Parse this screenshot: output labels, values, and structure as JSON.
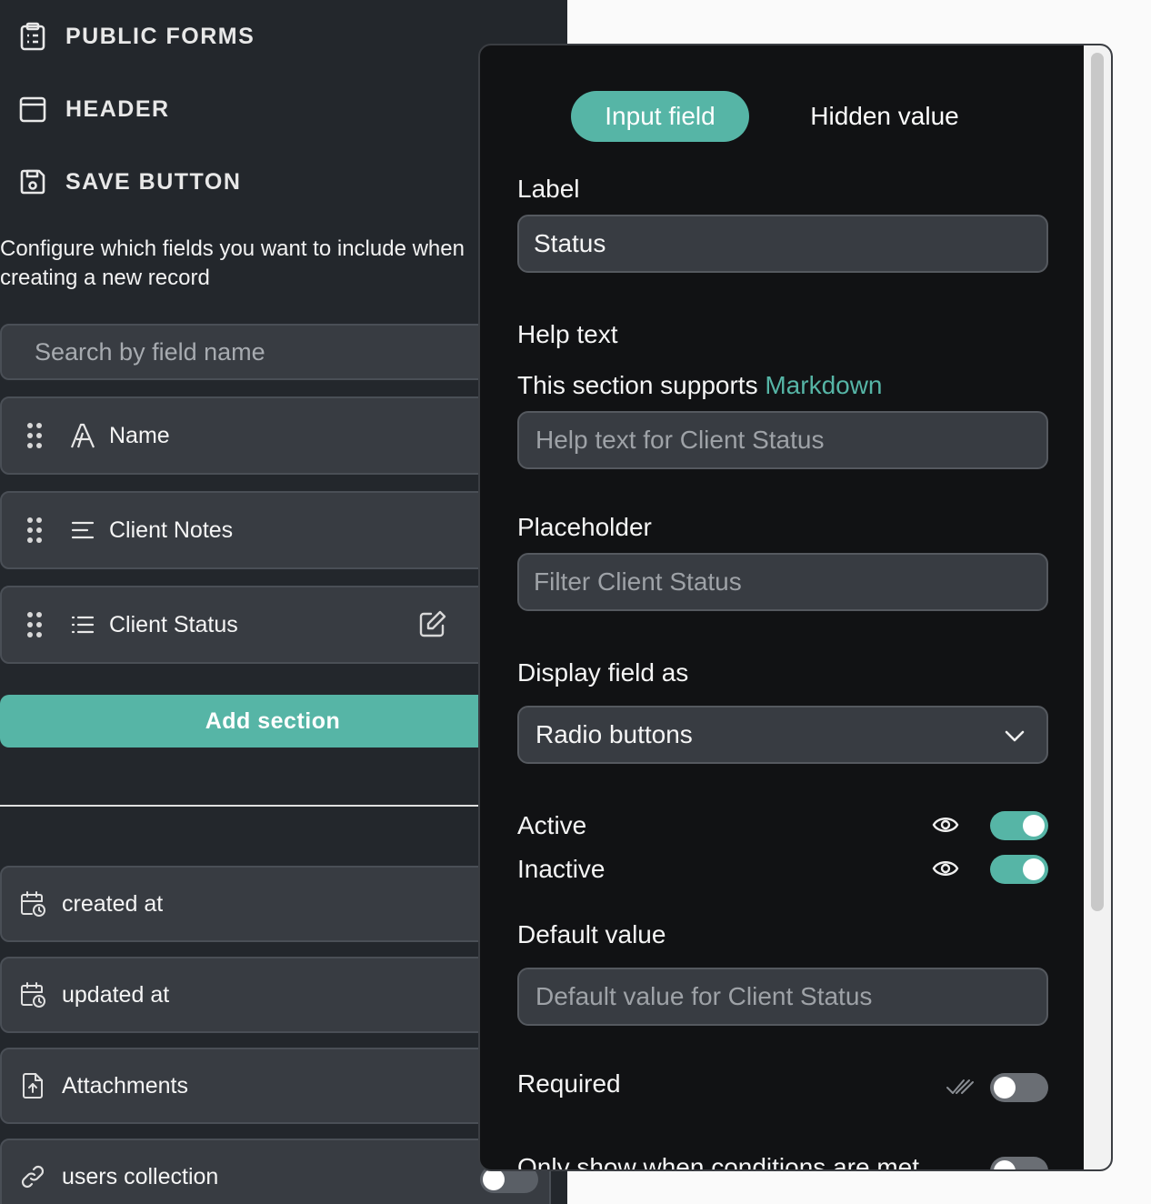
{
  "sidebar": {
    "nav": [
      {
        "label": "PUBLIC FORMS",
        "icon": "clipboard-list-icon"
      },
      {
        "label": "HEADER",
        "icon": "window-header-icon"
      },
      {
        "label": "SAVE BUTTON",
        "icon": "save-floppy-icon"
      }
    ],
    "description": "Configure which fields you want to include when creating a new record",
    "search_placeholder": "Search by field name",
    "fields": [
      {
        "name": "Name",
        "type_icon": "text-type-icon"
      },
      {
        "name": "Client Notes",
        "type_icon": "long-text-icon"
      },
      {
        "name": "Client Status",
        "type_icon": "list-icon"
      }
    ],
    "add_section_label": "Add section",
    "meta_fields": [
      {
        "name": "created at",
        "icon": "calendar-clock-icon"
      },
      {
        "name": "updated at",
        "icon": "calendar-clock-icon"
      },
      {
        "name": "Attachments",
        "icon": "file-upload-icon"
      },
      {
        "name": "users collection",
        "icon": "link-icon"
      }
    ]
  },
  "panel": {
    "tabs": {
      "active": "Input field",
      "inactive": "Hidden value"
    },
    "label_title": "Label",
    "label_value": "Status",
    "help_title": "Help text",
    "help_note_prefix": "This section supports ",
    "help_note_link": "Markdown",
    "help_placeholder": "Help text for Client Status",
    "placeholder_title": "Placeholder",
    "placeholder_placeholder": "Filter Client Status",
    "display_title": "Display field as",
    "display_value": "Radio buttons",
    "options": [
      {
        "label": "Active",
        "visible": true
      },
      {
        "label": "Inactive",
        "visible": true
      }
    ],
    "default_title": "Default value",
    "default_placeholder": "Default value for Client Status",
    "required_label": "Required",
    "conditions_label": "Only show when conditions are met"
  },
  "colors": {
    "accent": "#56b5a6",
    "sidebar_bg": "#23272c",
    "panel_bg": "#111214"
  }
}
